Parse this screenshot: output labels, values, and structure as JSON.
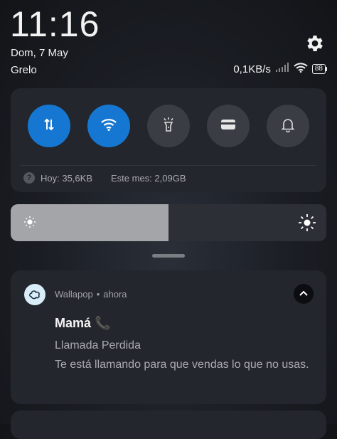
{
  "status": {
    "time": "11:16",
    "date": "Dom, 7 May",
    "carrier": "Grelo",
    "net_speed": "0,1KB/s",
    "battery": "88",
    "icons": [
      "settings-gear-icon",
      "signal-icon",
      "wifi-icon",
      "battery-icon"
    ]
  },
  "quick_settings": {
    "tiles": [
      {
        "name": "mobile-data",
        "icon": "mobile-data-arrows-icon",
        "active": true
      },
      {
        "name": "wifi",
        "icon": "wifi-icon",
        "active": true
      },
      {
        "name": "flashlight",
        "icon": "flashlight-icon",
        "active": false
      },
      {
        "name": "card",
        "icon": "card-icon",
        "active": false
      },
      {
        "name": "sound",
        "icon": "bell-icon",
        "active": false
      }
    ],
    "usage_today": "Hoy: 35,6KB",
    "usage_month": "Este mes: 2,09GB",
    "help_glyph": "?"
  },
  "brightness": {
    "level": 0.5
  },
  "notification": {
    "app": "Wallapop",
    "separator": "•",
    "time": "ahora",
    "title": "Mamá 📞",
    "subtitle": "Llamada Perdida",
    "body": "Te está llamando para que vendas lo que no usas."
  },
  "colors": {
    "accent": "#1677d2",
    "panel": "#23262c"
  }
}
